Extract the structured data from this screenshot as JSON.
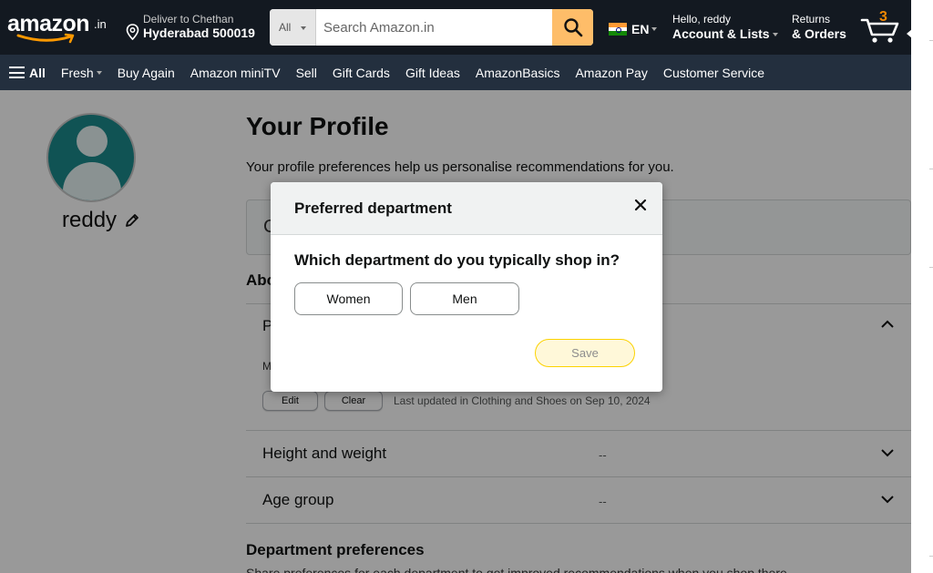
{
  "header": {
    "logo_text": "amazon",
    "logo_tld": ".in",
    "deliver_line1": "Deliver to Chethan",
    "deliver_line2": "Hyderabad 500019",
    "search_category": "All",
    "search_placeholder": "Search Amazon.in",
    "language": "EN",
    "account_line1": "Hello, reddy",
    "account_line2": "Account & Lists",
    "returns_line1": "Returns",
    "returns_line2": "& Orders",
    "cart_count": "3"
  },
  "nav": {
    "all": "All",
    "items": [
      "Fresh",
      "Buy Again",
      "Amazon miniTV",
      "Sell",
      "Gift Cards",
      "Gift Ideas",
      "AmazonBasics",
      "Amazon Pay",
      "Customer Service"
    ]
  },
  "profile": {
    "username": "reddy",
    "title": "Your Profile",
    "subtitle": "Your profile preferences help us personalise recommendations for you.",
    "box_partial": "C",
    "about_partial": "Abo",
    "pref_row_partial": "P",
    "pref_value_partial": "M",
    "edit_label": "Edit",
    "clear_label": "Clear",
    "last_updated": "Last updated in Clothing and Shoes on Sep 10, 2024",
    "rows": [
      {
        "title": "Height and weight",
        "value": "--"
      },
      {
        "title": "Age group",
        "value": "--"
      }
    ],
    "dept_title": "Department preferences",
    "dept_desc": "Share preferences for each department to get improved recommendations when you shop there."
  },
  "modal": {
    "title": "Preferred department",
    "question": "Which department do you typically shop in?",
    "options": [
      "Women",
      "Men"
    ],
    "save_label": "Save"
  },
  "colors": {
    "header_bg": "#131921",
    "subnav_bg": "#232f3e",
    "search_button": "#febd69",
    "cart_count": "#f08804",
    "save_border": "#fcd200"
  },
  "icons": [
    "location-pin-icon",
    "search-icon",
    "india-flag-icon",
    "cart-icon",
    "hamburger-icon",
    "pencil-icon",
    "close-icon",
    "chevron-up-icon",
    "chevron-down-icon"
  ]
}
